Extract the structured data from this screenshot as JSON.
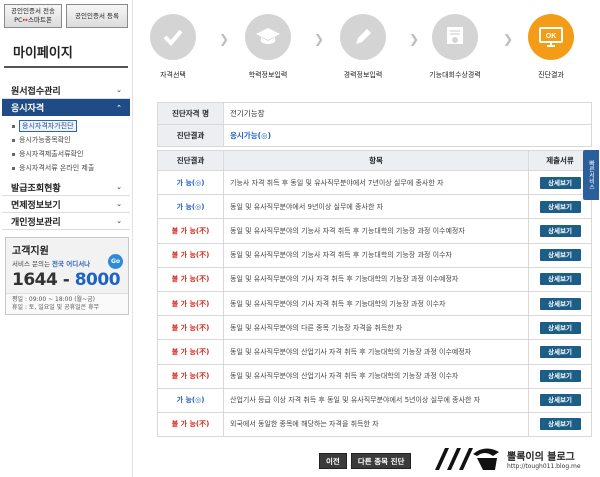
{
  "sidebar": {
    "top_buttons": [
      {
        "line1": "공인인증서 전송",
        "line2a": "PC",
        "line2b": "스마트폰"
      },
      {
        "line1": "공인인증서 등록"
      }
    ],
    "title": "마이페이지",
    "menu": [
      {
        "label": "원서접수관리",
        "chevron": "v"
      },
      {
        "label": "응시자격",
        "chevron": "^"
      },
      {
        "label": "발급조회현황",
        "chevron": "v"
      },
      {
        "label": "면제정보보기",
        "chevron": "v"
      },
      {
        "label": "개인정보관리",
        "chevron": "v"
      }
    ],
    "submenu": [
      "응시자격자가진단",
      "응시가능종목확인",
      "응시자격제출서류확인",
      "응시자격서류 온라인 제출"
    ],
    "support": {
      "title": "고객지원",
      "line_prefix": "서비스 문의는 ",
      "line_highlight": "전국 어디서나",
      "go": "Go",
      "phone_a": "1644 - ",
      "phone_b": "8000",
      "hours1": "평일 : 09:00 ~ 18:00 (월~금)",
      "hours2": "휴일 : 토, 일요일 및 공휴일은 휴무"
    }
  },
  "steps": [
    {
      "label": "자격선택",
      "icon": "check-icon"
    },
    {
      "label": "학력정보입력",
      "icon": "graduation-cap-icon"
    },
    {
      "label": "경력정보입력",
      "icon": "pencil-icon"
    },
    {
      "label": "기능대회수상경력",
      "icon": "certificate-icon"
    },
    {
      "label": "진단결과",
      "icon": "ok-monitor-icon",
      "ok_text": "OK"
    }
  ],
  "diagnosis": {
    "qual_label": "진단자격 명",
    "qual_value": "전기기능장",
    "result_label": "진단결과",
    "result_value": "응시가능(◎)"
  },
  "result_table": {
    "headers": [
      "진단결과",
      "항목",
      "제출서류"
    ],
    "button_label": "상세보기",
    "rows": [
      {
        "status": "가 능(◎)",
        "ok": true,
        "item": "기능사 자격 취득 후 동일 및 유사직무분야에서 7년이상 실무에 종사한 자"
      },
      {
        "status": "가 능(◎)",
        "ok": true,
        "item": "동일 및 유사직무분야에서 9년이상 실무에 종사한 자"
      },
      {
        "status": "불 가 능(不)",
        "ok": false,
        "item": "동일 및 유사직무분야의 기능사 자격 취득 후 기능대학의 기능장 과정 이수예정자"
      },
      {
        "status": "불 가 능(不)",
        "ok": false,
        "item": "동일 및 유사직무분야의 기능사 자격 취득 후 기능대학의 기능장 과정 이수자"
      },
      {
        "status": "불 가 능(不)",
        "ok": false,
        "item": "동일 및 유사직무분야의 기사 자격 취득 후 기능대학의 기능장 과정 이수예정자"
      },
      {
        "status": "불 가 능(不)",
        "ok": false,
        "item": "동일 및 유사직무분야의 기사 자격 취득 후 기능대학의 기능장 과정 이수자"
      },
      {
        "status": "불 가 능(不)",
        "ok": false,
        "item": "동일 및 유사직무분야의 다른 종목 기능장 자격을 취득한 자"
      },
      {
        "status": "불 가 능(不)",
        "ok": false,
        "item": "동일 및 유사직무분야의 산업기사 자격 취득 후 기능대학의 기능장 과정 이수예정자"
      },
      {
        "status": "불 가 능(不)",
        "ok": false,
        "item": "동일 및 유사직무분야의 산업기사 자격 취득 후 기능대학의 기능장 과정 이수자"
      },
      {
        "status": "가 능(◎)",
        "ok": true,
        "item": "산업기사 등급 이상 자격 취득 후 동일 및 유사직무분야에서 5년이상 실무에 종사한 자"
      },
      {
        "status": "불 가 능(不)",
        "ok": false,
        "item": "외국에서 동일한 종목에 해당하는 자격을 취득한 자"
      }
    ]
  },
  "bottom": {
    "prev": "이전",
    "other": "다른 종목 진단"
  },
  "side_tab": "빠른서비스",
  "watermark": {
    "title": "뽈록이의 블로그",
    "url": "http://tough011.blog.me"
  }
}
